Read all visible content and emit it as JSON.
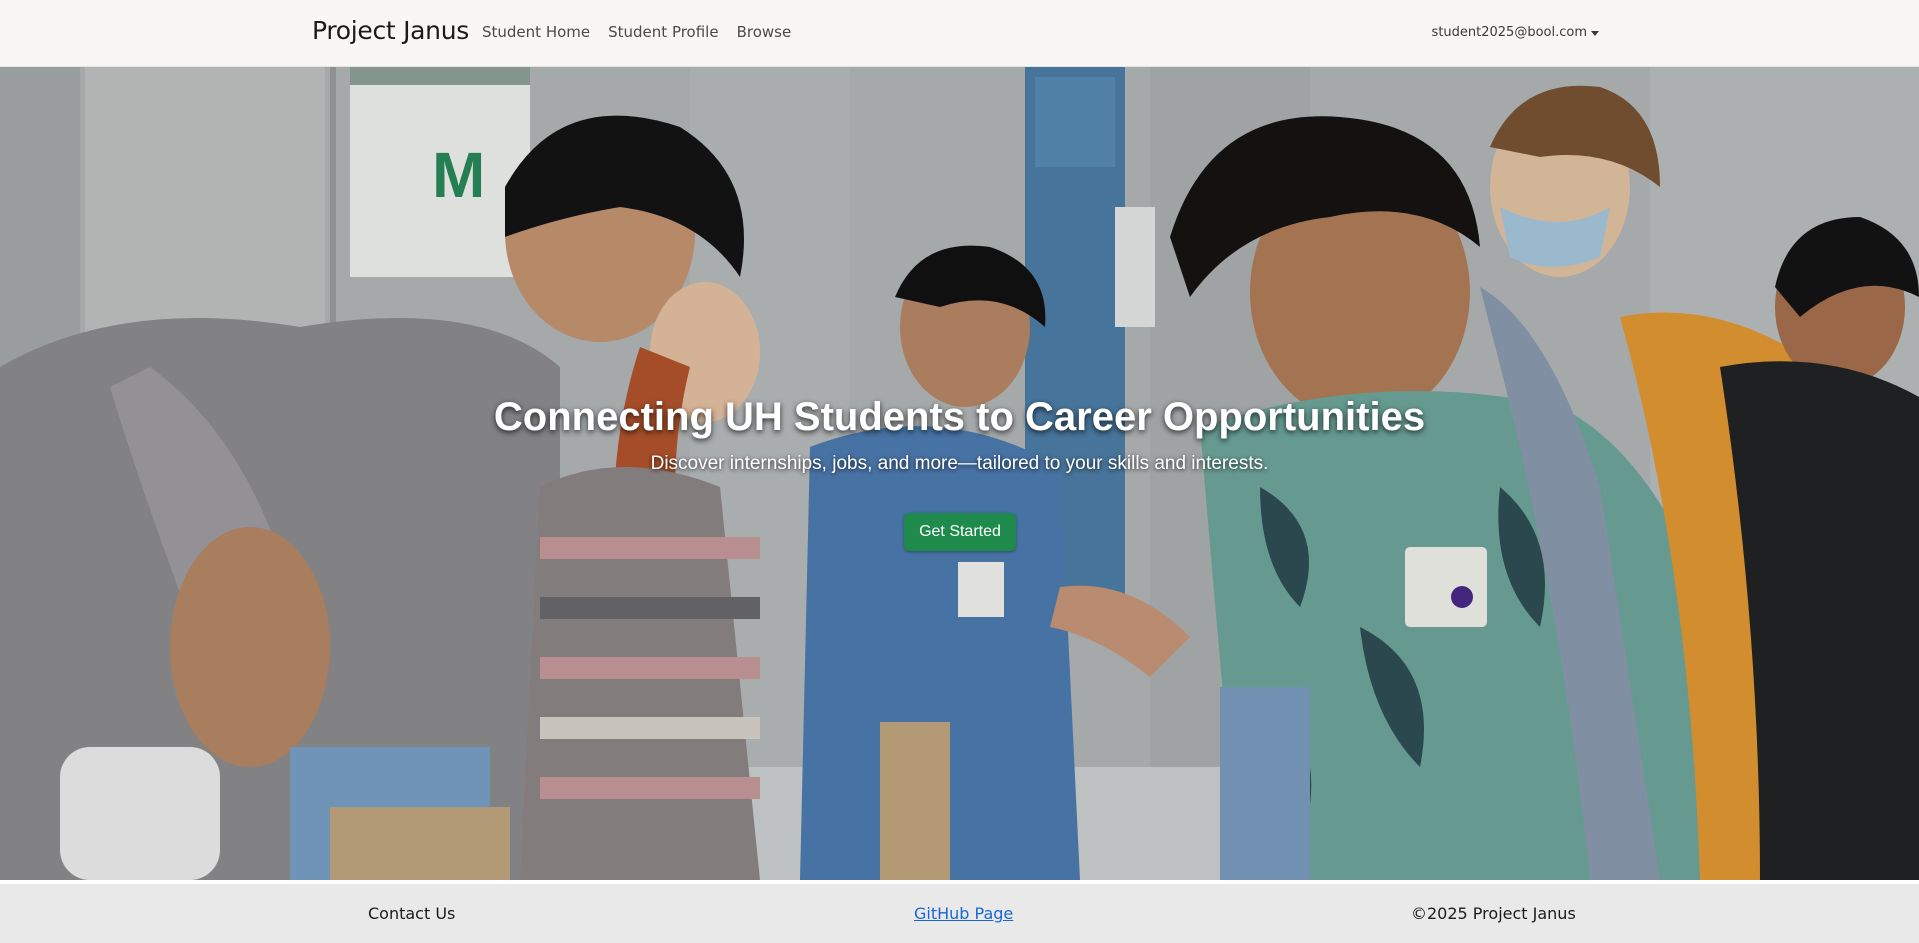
{
  "navbar": {
    "brand": "Project Janus",
    "links": [
      {
        "label": "Student Home"
      },
      {
        "label": "Student Profile"
      },
      {
        "label": "Browse"
      }
    ],
    "user_email": "student2025@bool.com"
  },
  "hero": {
    "title": "Connecting UH Students to Career Opportunities",
    "subtitle": "Discover internships, jobs, and more—tailored to your skills and interests.",
    "cta_label": "Get Started"
  },
  "footer": {
    "contact": "Contact Us",
    "github": "GitHub Page",
    "copyright": "©2025 Project Janus"
  },
  "colors": {
    "cta": "#1e8a4c",
    "link": "#1a66d6",
    "navbar_bg": "#f8f7f5",
    "footer_bg": "#e9e9ea"
  }
}
